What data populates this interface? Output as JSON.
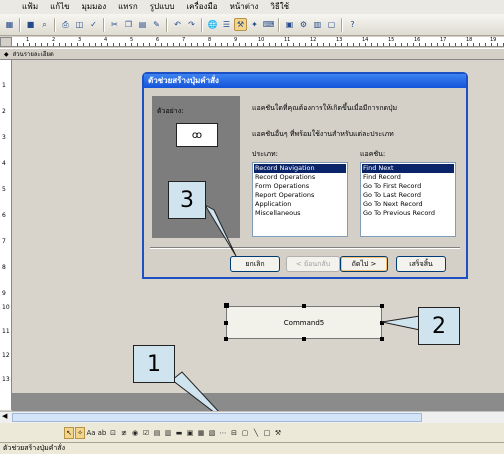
{
  "menu": [
    "แฟ้ม",
    "แก้ไข",
    "มุมมอง",
    "แทรก",
    "รูปแบบ",
    "เครื่องมือ",
    "หน้าต่าง",
    "วิธีใช้"
  ],
  "ruler_numbers": [
    "1",
    "2",
    "3",
    "4",
    "5",
    "6",
    "7",
    "8",
    "9",
    "10",
    "11",
    "12",
    "13",
    "14",
    "15",
    "16",
    "17",
    "18",
    "19"
  ],
  "vruler_numbers": [
    "1",
    "2",
    "3",
    "4",
    "5",
    "6",
    "7",
    "8",
    "9",
    "10",
    "11",
    "12",
    "13"
  ],
  "section_header": "ส่วนรายละเอียด",
  "dialog": {
    "title": "ตัวช่วยสร้างปุ่มคำสั่ง",
    "sample_label": "ตัวอย่าง:",
    "message1": "แอคชันใดที่คุณต้องการให้เกิดขึ้นเมื่อมีการกดปุ่ม",
    "message2": "แอคชันอื่นๆ ที่พร้อมใช้งานสำหรับแต่ละประเภท",
    "categories_label": "ประเภท:",
    "actions_label": "แอคชัน:",
    "categories": [
      "Record Navigation",
      "Record Operations",
      "Form Operations",
      "Report Operations",
      "Application",
      "Miscellaneous"
    ],
    "actions": [
      "Find Next",
      "Find Record",
      "Go To First Record",
      "Go To Last Record",
      "Go To Next Record",
      "Go To Previous Record"
    ],
    "buttons": {
      "cancel": "ยกเลิก",
      "back": "< ย้อนกลับ",
      "next": "ถัดไป >",
      "finish": "เสร็จสิ้น"
    }
  },
  "command_button_caption": "Command5",
  "callouts": [
    "1",
    "2",
    "3"
  ],
  "status_text": "ตัวช่วยสร้างปุ่มคำสั่ง",
  "colors": {
    "title_bar": "#1454d9",
    "selection": "#0a246a",
    "callout_fill": "#cfe4ee"
  }
}
